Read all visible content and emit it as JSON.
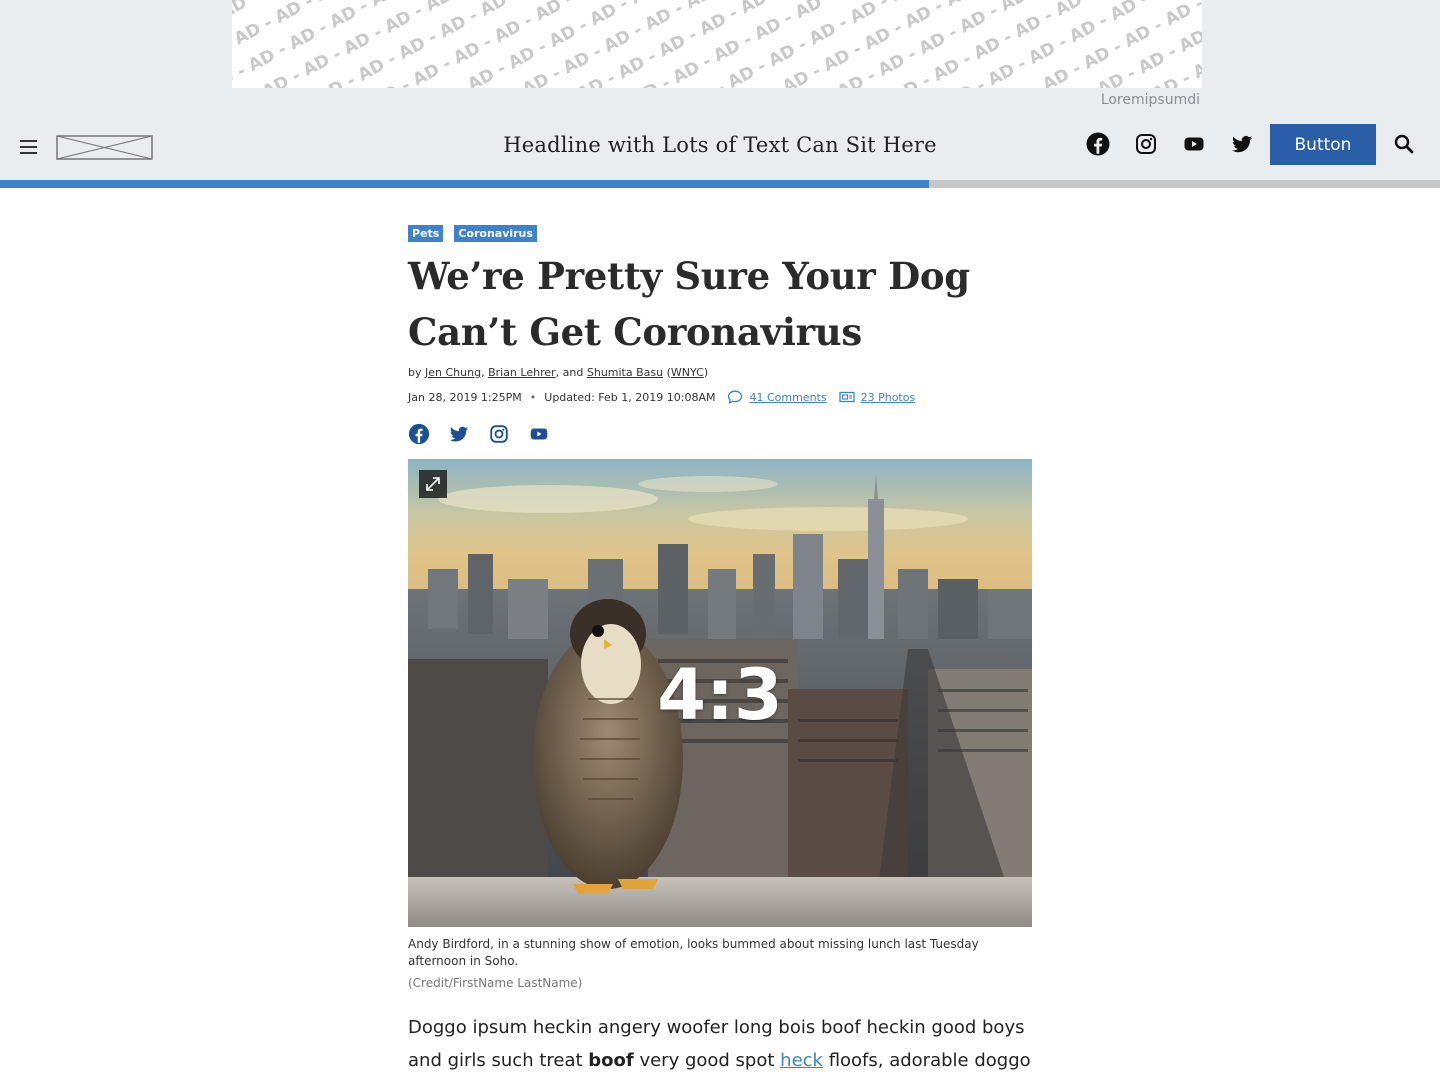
{
  "ad": {
    "text": "AD",
    "caption": "Loremipsumdi"
  },
  "nav": {
    "headline": "Headline with Lots of Text Can Sit Here",
    "button_label": "Button",
    "social_icons": [
      "facebook-icon",
      "instagram-icon",
      "youtube-icon",
      "twitter-icon"
    ],
    "read_progress": 0.645
  },
  "article": {
    "tags": [
      "Pets",
      "Coronavirus"
    ],
    "title": "We’re Pretty Sure Your Dog Can’t Get Coronavirus",
    "byline": {
      "prefix": "by",
      "authors": [
        "Jen Chung",
        "Brian Lehrer",
        "Shumita Basu"
      ],
      "sep1": ",",
      "sep2": ", and",
      "outlet": "WNYC"
    },
    "meta": {
      "published": "Jan 28, 2019 1:25PM",
      "dot": "•",
      "updated": "Updated: Feb 1, 2019 10:08AM",
      "comments": "41 Comments",
      "photos": "23 Photos"
    },
    "hero": {
      "ratio_label": "4:3",
      "caption": "Andy Birdford, in a stunning show of emotion, looks bummed about missing lunch last Tuesday afternoon in Soho.",
      "credit": "(Credit/FirstName LastName)"
    },
    "body": {
      "p1_a": "Doggo ipsum heckin angery woofer long bois boof heckin good boys and girls such treat ",
      "p1_bold": "boof",
      "p1_b": " very good spot ",
      "p1_link": "heck",
      "p1_c": " floofs, adorable doggo puggo"
    }
  },
  "colors": {
    "accent": "#3f82c9",
    "button": "#2a5fa8",
    "band": "#e9edf0"
  }
}
